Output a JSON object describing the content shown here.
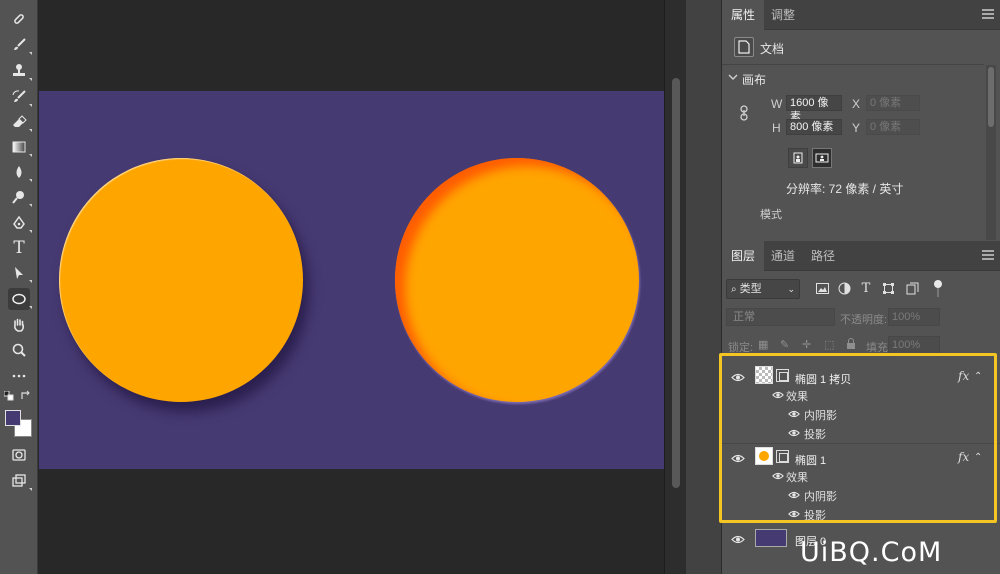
{
  "toolbar": {
    "tools": [
      "healing-brush",
      "brush",
      "clone-stamp",
      "history-brush",
      "eraser",
      "gradient",
      "blur",
      "dodge",
      "pen",
      "type",
      "path-selection",
      "ellipse",
      "hand",
      "zoom",
      "more"
    ],
    "active_tool": "ellipse",
    "type_tool_glyph": "T",
    "foreground_color": "#463a72",
    "background_color": "#ffffff"
  },
  "canvas": {
    "background_color": "#463a72",
    "circle_color": "#ffa500"
  },
  "properties_panel": {
    "tabs": [
      "属性",
      "调整"
    ],
    "active_tab": "属性",
    "doc_label": "文档",
    "canvas_heading": "画布",
    "w_label": "W",
    "h_label": "H",
    "x_label": "X",
    "y_label": "Y",
    "width_value": "1600 像素",
    "height_value": "800 像素",
    "x_placeholder": "0 像素",
    "y_placeholder": "0 像素",
    "resolution": "分辨率: 72 像素 / 英寸",
    "mode_label": "模式"
  },
  "layers_panel": {
    "tabs": [
      "图层",
      "通道",
      "路径"
    ],
    "active_tab": "图层",
    "filter_kind": "类型",
    "blend_mode": "正常",
    "opacity_label": "不透明度:",
    "opacity_value": "100%",
    "lock_label": "锁定:",
    "fill_label": "填充:",
    "fill_value": "100%",
    "fx_label": "fx",
    "layers": [
      {
        "name": "椭圆 1 拷贝",
        "effects_label": "效果",
        "effects": [
          "内阴影",
          "投影"
        ]
      },
      {
        "name": "椭圆 1",
        "effects_label": "效果",
        "effects": [
          "内阴影",
          "投影"
        ]
      },
      {
        "name": "图层 0"
      }
    ],
    "highlight_color": "#f5c523"
  },
  "watermark": "UiBQ.CoM"
}
